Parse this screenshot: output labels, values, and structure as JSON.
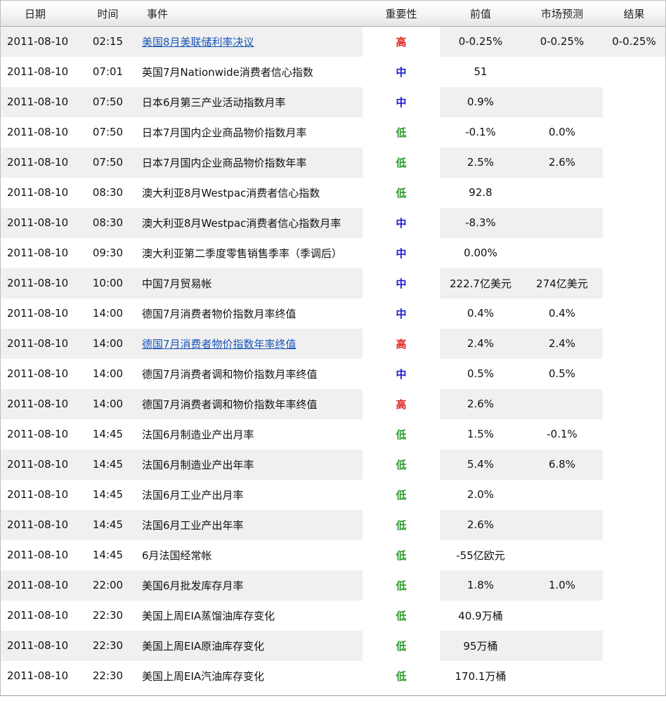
{
  "columns": {
    "date": "日期",
    "time": "时间",
    "event": "事件",
    "importance": "重要性",
    "previous": "前值",
    "forecast": "市场预测",
    "result": "结果"
  },
  "importance_colors": {
    "高": "#e0201a",
    "中": "#1a1ad0",
    "低": "#2a9a2a"
  },
  "link_color": "#1a56b8",
  "rows": [
    {
      "date": "2011-08-10",
      "time": "02:15",
      "event": "美国8月美联储利率决议",
      "link": true,
      "importance": "高",
      "previous": "0-0.25%",
      "forecast": "0-0.25%",
      "result": "0-0.25%"
    },
    {
      "date": "2011-08-10",
      "time": "07:01",
      "event": "英国7月Nationwide消费者信心指数",
      "link": false,
      "importance": "中",
      "previous": "51",
      "forecast": "",
      "result": ""
    },
    {
      "date": "2011-08-10",
      "time": "07:50",
      "event": "日本6月第三产业活动指数月率",
      "link": false,
      "importance": "中",
      "previous": "0.9%",
      "forecast": "",
      "result": ""
    },
    {
      "date": "2011-08-10",
      "time": "07:50",
      "event": "日本7月国内企业商品物价指数月率",
      "link": false,
      "importance": "低",
      "previous": "-0.1%",
      "forecast": "0.0%",
      "result": ""
    },
    {
      "date": "2011-08-10",
      "time": "07:50",
      "event": "日本7月国内企业商品物价指数年率",
      "link": false,
      "importance": "低",
      "previous": "2.5%",
      "forecast": "2.6%",
      "result": ""
    },
    {
      "date": "2011-08-10",
      "time": "08:30",
      "event": "澳大利亚8月Westpac消费者信心指数",
      "link": false,
      "importance": "低",
      "previous": "92.8",
      "forecast": "",
      "result": ""
    },
    {
      "date": "2011-08-10",
      "time": "08:30",
      "event": "澳大利亚8月Westpac消费者信心指数月率",
      "link": false,
      "importance": "中",
      "previous": "-8.3%",
      "forecast": "",
      "result": ""
    },
    {
      "date": "2011-08-10",
      "time": "09:30",
      "event": "澳大利亚第二季度零售销售季率（季调后）",
      "link": false,
      "importance": "中",
      "previous": "0.00%",
      "forecast": "",
      "result": ""
    },
    {
      "date": "2011-08-10",
      "time": "10:00",
      "event": "中国7月贸易帐",
      "link": false,
      "importance": "中",
      "previous": "222.7亿美元",
      "forecast": "274亿美元",
      "result": ""
    },
    {
      "date": "2011-08-10",
      "time": "14:00",
      "event": "德国7月消费者物价指数月率终值",
      "link": false,
      "importance": "中",
      "previous": "0.4%",
      "forecast": "0.4%",
      "result": ""
    },
    {
      "date": "2011-08-10",
      "time": "14:00",
      "event": "德国7月消费者物价指数年率终值",
      "link": true,
      "importance": "高",
      "previous": "2.4%",
      "forecast": "2.4%",
      "result": ""
    },
    {
      "date": "2011-08-10",
      "time": "14:00",
      "event": "德国7月消费者调和物价指数月率终值",
      "link": false,
      "importance": "中",
      "previous": "0.5%",
      "forecast": "0.5%",
      "result": ""
    },
    {
      "date": "2011-08-10",
      "time": "14:00",
      "event": "德国7月消费者调和物价指数年率终值",
      "link": false,
      "importance": "高",
      "previous": "2.6%",
      "forecast": "",
      "result": ""
    },
    {
      "date": "2011-08-10",
      "time": "14:45",
      "event": "法国6月制造业产出月率",
      "link": false,
      "importance": "低",
      "previous": "1.5%",
      "forecast": "-0.1%",
      "result": ""
    },
    {
      "date": "2011-08-10",
      "time": "14:45",
      "event": "法国6月制造业产出年率",
      "link": false,
      "importance": "低",
      "previous": "5.4%",
      "forecast": "6.8%",
      "result": ""
    },
    {
      "date": "2011-08-10",
      "time": "14:45",
      "event": "法国6月工业产出月率",
      "link": false,
      "importance": "低",
      "previous": "2.0%",
      "forecast": "",
      "result": ""
    },
    {
      "date": "2011-08-10",
      "time": "14:45",
      "event": "法国6月工业产出年率",
      "link": false,
      "importance": "低",
      "previous": "2.6%",
      "forecast": "",
      "result": ""
    },
    {
      "date": "2011-08-10",
      "time": "14:45",
      "event": "6月法国经常帐",
      "link": false,
      "importance": "低",
      "previous": "-55亿欧元",
      "forecast": "",
      "result": ""
    },
    {
      "date": "2011-08-10",
      "time": "22:00",
      "event": "美国6月批发库存月率",
      "link": false,
      "importance": "低",
      "previous": "1.8%",
      "forecast": "1.0%",
      "result": ""
    },
    {
      "date": "2011-08-10",
      "time": "22:30",
      "event": "美国上周EIA蒸馏油库存变化",
      "link": false,
      "importance": "低",
      "previous": "40.9万桶",
      "forecast": "",
      "result": ""
    },
    {
      "date": "2011-08-10",
      "time": "22:30",
      "event": "美国上周EIA原油库存变化",
      "link": false,
      "importance": "低",
      "previous": "95万桶",
      "forecast": "",
      "result": ""
    },
    {
      "date": "2011-08-10",
      "time": "22:30",
      "event": "美国上周EIA汽油库存变化",
      "link": false,
      "importance": "低",
      "previous": "170.1万桶",
      "forecast": "",
      "result": ""
    }
  ]
}
